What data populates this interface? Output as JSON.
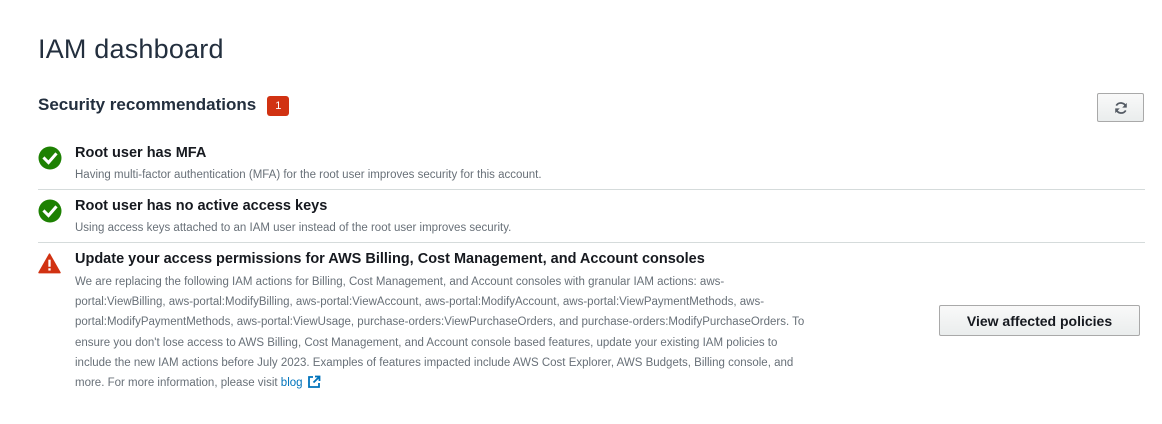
{
  "page": {
    "title": "IAM dashboard"
  },
  "security": {
    "title": "Security recommendations",
    "badge_count": "1",
    "refresh_icon": "refresh-icon"
  },
  "recommendations": [
    {
      "status": "success",
      "icon": "check-circle-icon",
      "title": "Root user has MFA",
      "description": "Having multi-factor authentication (MFA) for the root user improves security for this account."
    },
    {
      "status": "success",
      "icon": "check-circle-icon",
      "title": "Root user has no active access keys",
      "description": "Using access keys attached to an IAM user instead of the root user improves security."
    },
    {
      "status": "warning",
      "icon": "warning-triangle-icon",
      "title": "Update your access permissions for AWS Billing, Cost Management, and Account consoles",
      "description_lines": [
        "We are replacing the following IAM actions for Billing, Cost Management, and Account consoles with granular IAM actions: aws-",
        "portal:ViewBilling, aws-portal:ModifyBilling, aws-portal:ViewAccount, aws-portal:ModifyAccount, aws-portal:ViewPaymentMethods, aws-",
        "portal:ModifyPaymentMethods, aws-portal:ViewUsage, purchase-orders:ViewPurchaseOrders, and purchase-orders:ModifyPurchaseOrders. To",
        "ensure you don't lose access to AWS Billing, Cost Management, and Account console based features, update your existing IAM policies to",
        "include the new IAM actions before July 2023. Examples of features impacted include AWS Cost Explorer, AWS Budgets, Billing console, and",
        "more. For more information, please visit "
      ],
      "link_label": "blog",
      "link_icon": "external-link-icon",
      "action_label": "View affected policies"
    }
  ],
  "colors": {
    "success": "#1d8102",
    "warning": "#d13212",
    "badge": "#d13212",
    "link": "#0073bb"
  }
}
